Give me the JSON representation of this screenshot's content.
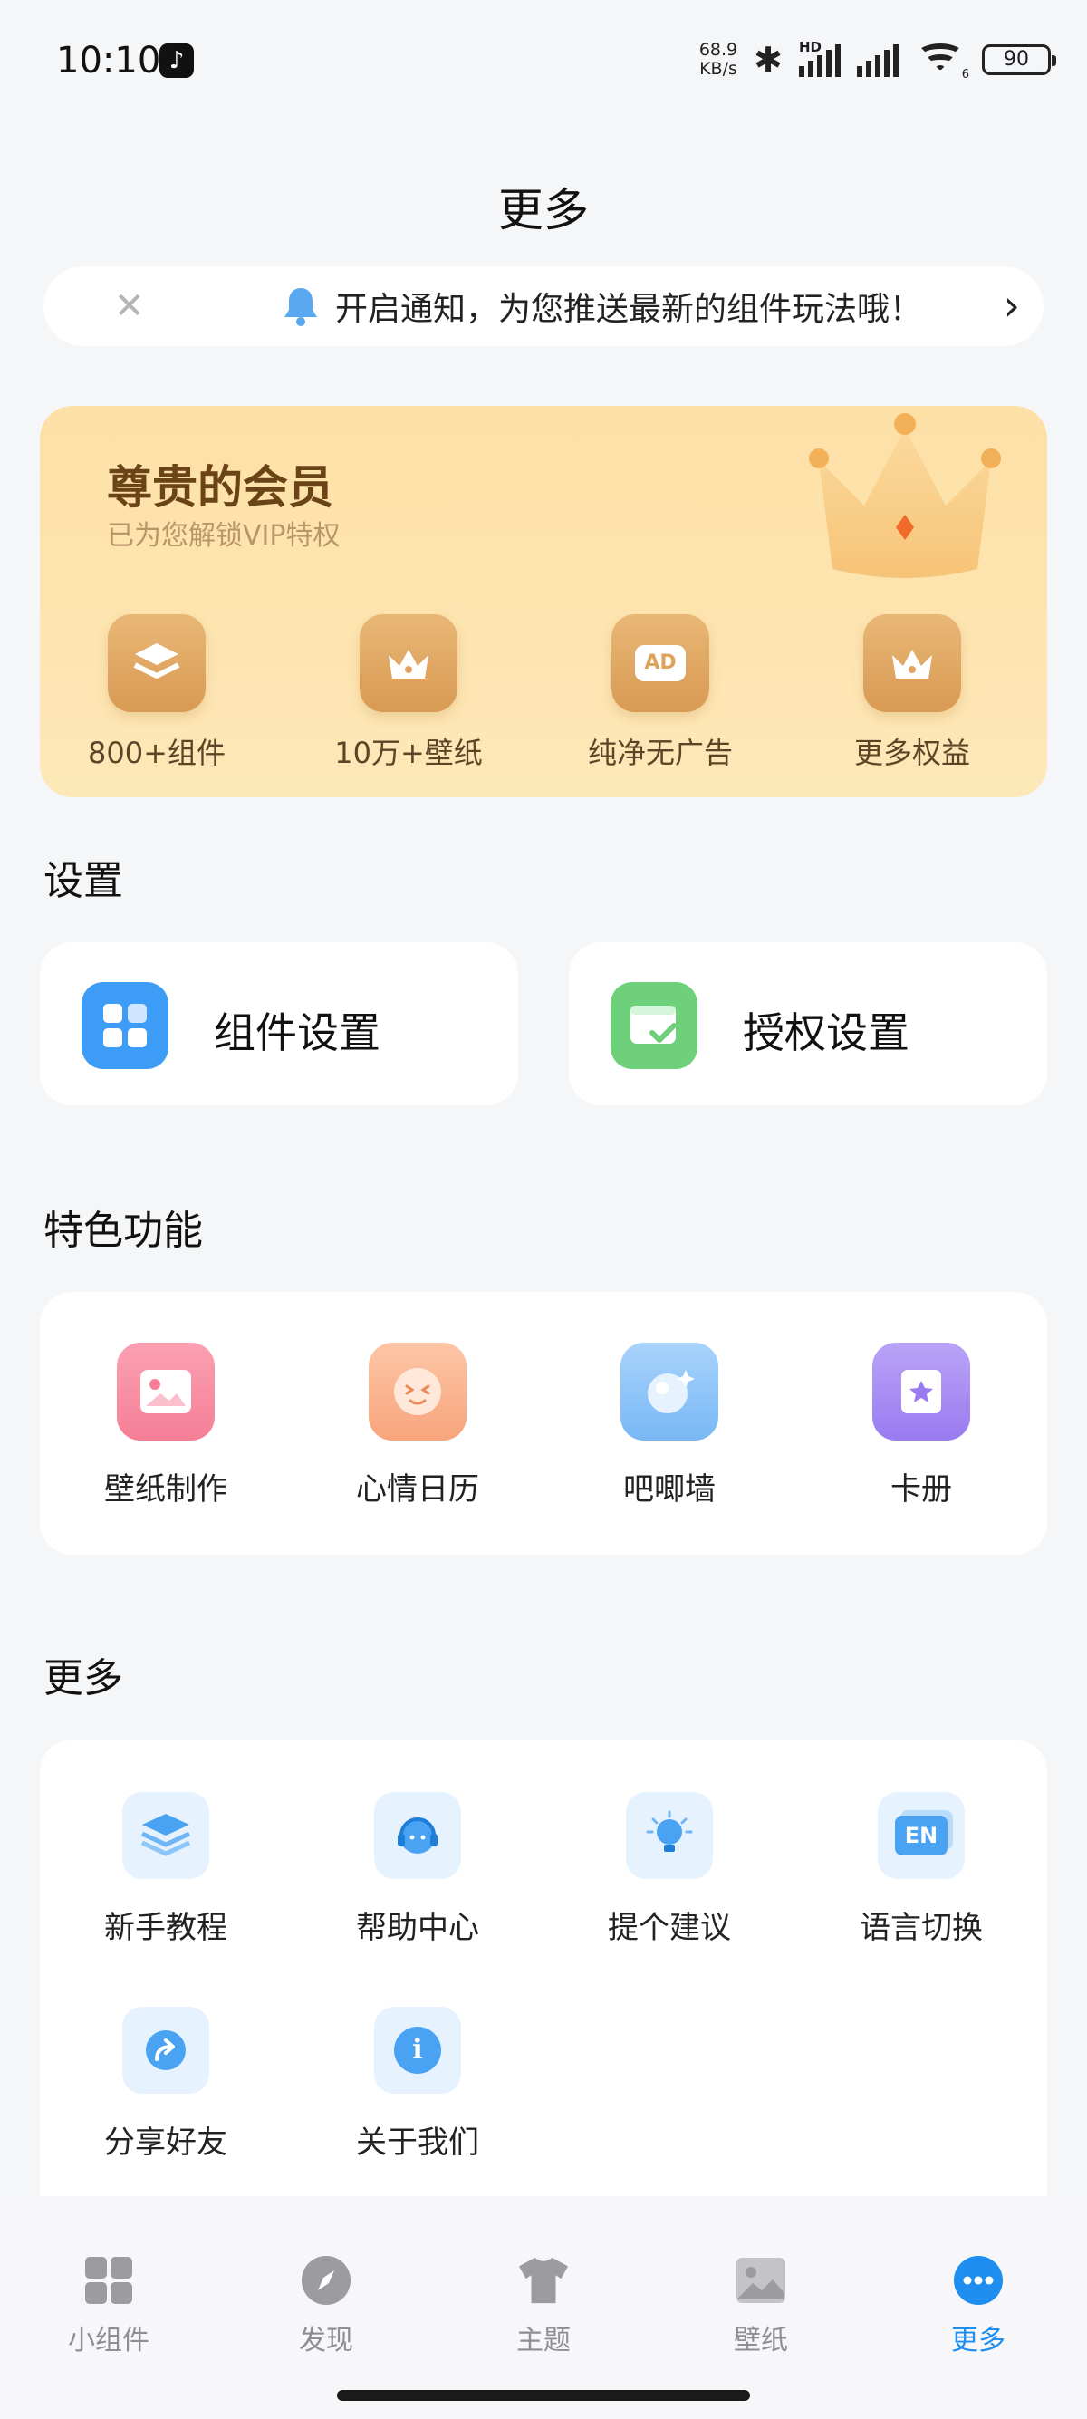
{
  "status": {
    "time": "10:10",
    "net_speed_value": "68.9",
    "net_speed_unit": "KB/s",
    "hd": "HD",
    "wifi_sub": "6",
    "battery": "90"
  },
  "header": {
    "title": "更多"
  },
  "notice": {
    "text": "开启通知，为您推送最新的组件玩法哦！"
  },
  "vip": {
    "title": "尊贵的会员",
    "subtitle": "已为您解锁VIP特权",
    "perks": [
      {
        "label": "800+组件",
        "icon": "layers-icon"
      },
      {
        "label": "10万+壁纸",
        "icon": "crown-icon"
      },
      {
        "label": "纯净无广告",
        "icon": "ad-icon",
        "icon_text": "AD"
      },
      {
        "label": "更多权益",
        "icon": "crown-icon"
      }
    ]
  },
  "settings": {
    "title": "设置",
    "items": [
      {
        "label": "组件设置",
        "icon": "widget-grid-icon",
        "color": "#3d9cf5"
      },
      {
        "label": "授权设置",
        "icon": "auth-check-icon",
        "color": "#6fd07b"
      }
    ]
  },
  "features": {
    "title": "特色功能",
    "items": [
      {
        "label": "壁纸制作",
        "icon": "wallpaper-make-icon",
        "color": "#f57f96"
      },
      {
        "label": "心情日历",
        "icon": "mood-face-icon",
        "color": "#f8a47c"
      },
      {
        "label": "吧唧墙",
        "icon": "badge-wall-icon",
        "color": "#79b8f6"
      },
      {
        "label": "卡册",
        "icon": "card-album-icon",
        "color": "#9a7bf0"
      }
    ]
  },
  "more": {
    "title": "更多",
    "items": [
      {
        "label": "新手教程",
        "icon": "tutorial-stack-icon"
      },
      {
        "label": "帮助中心",
        "icon": "headset-icon"
      },
      {
        "label": "提个建议",
        "icon": "bulb-icon"
      },
      {
        "label": "语言切换",
        "icon": "language-en-icon",
        "icon_text": "EN"
      },
      {
        "label": "分享好友",
        "icon": "share-icon"
      },
      {
        "label": "关于我们",
        "icon": "info-icon",
        "icon_text": "i"
      }
    ]
  },
  "tabbar": {
    "tabs": [
      {
        "label": "小组件",
        "icon": "widgets-tab-icon",
        "active": false
      },
      {
        "label": "发现",
        "icon": "compass-tab-icon",
        "active": false
      },
      {
        "label": "主题",
        "icon": "shirt-tab-icon",
        "active": false
      },
      {
        "label": "壁纸",
        "icon": "picture-tab-icon",
        "active": false
      },
      {
        "label": "更多",
        "icon": "more-dots-tab-icon",
        "active": true
      }
    ],
    "active_color": "#1e8ef0"
  }
}
